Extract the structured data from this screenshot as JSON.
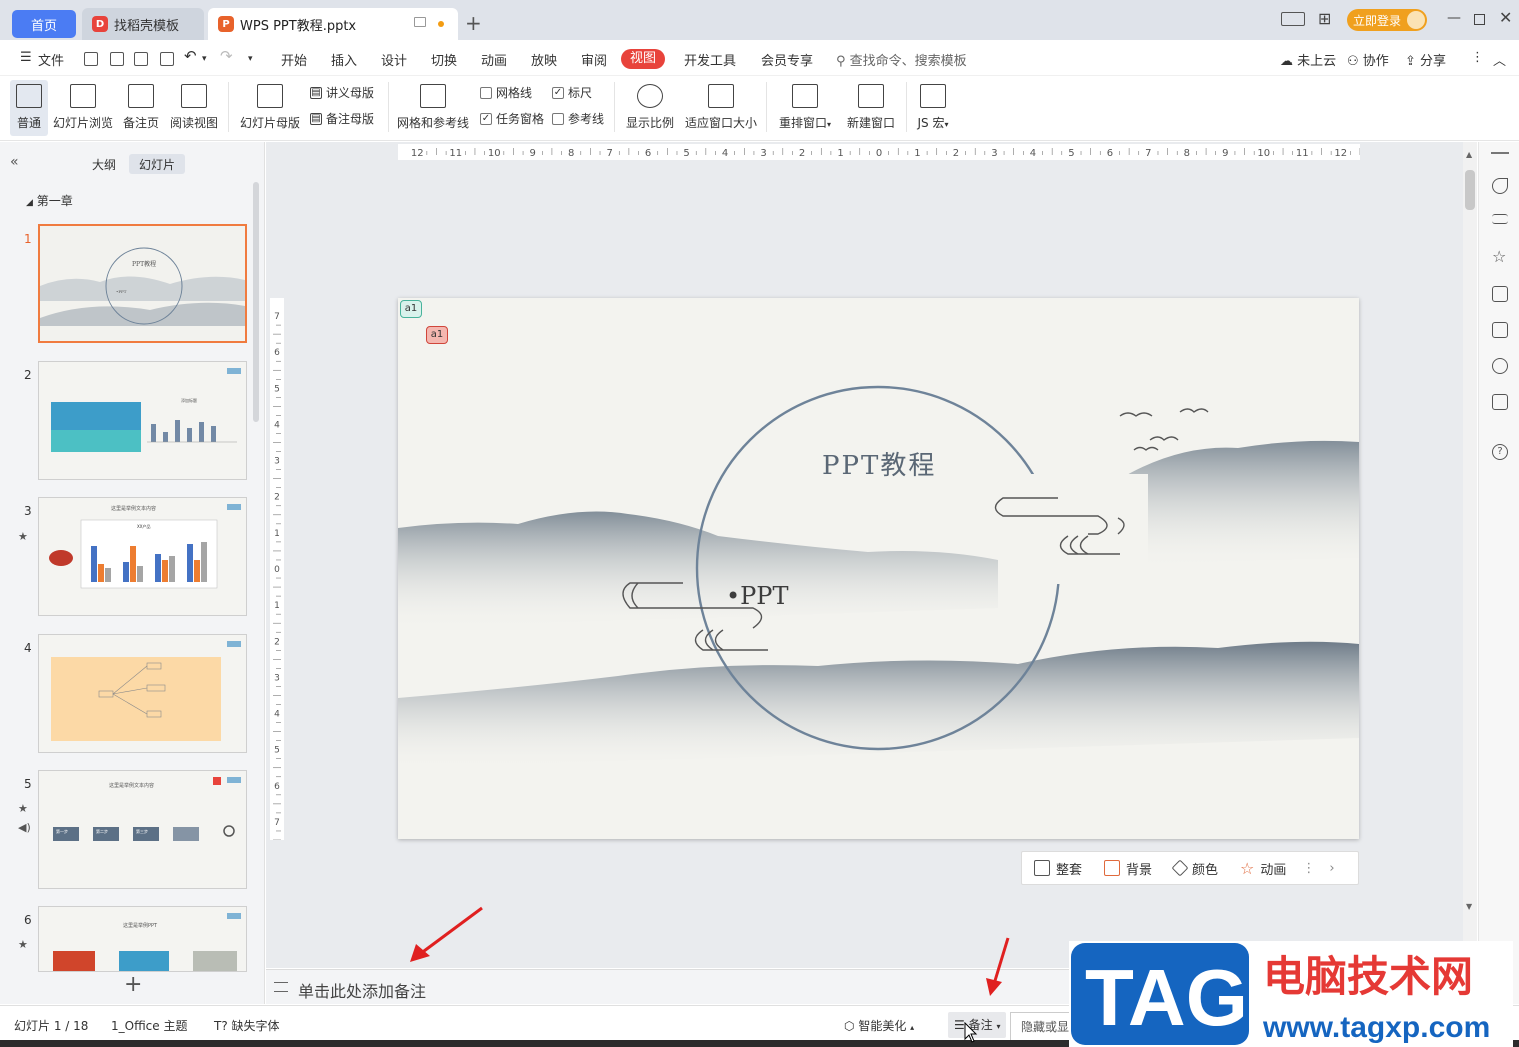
{
  "tabs": {
    "home": "首页",
    "template": "找稻壳模板",
    "document": "WPS PPT教程.pptx"
  },
  "window": {
    "login": "立即登录",
    "layout_icon": "layout-icon",
    "grid_icon": "grid-icon"
  },
  "menu": {
    "file": "文件",
    "items": [
      "开始",
      "插入",
      "设计",
      "切换",
      "动画",
      "放映",
      "审阅"
    ],
    "active": "视图",
    "items_after": [
      "开发工具",
      "会员专享"
    ],
    "search": "查找命令、搜索模板",
    "cloud": "未上云",
    "collab": "协作",
    "share": "分享"
  },
  "ribbon": {
    "normal": "普通",
    "slide_browse": "幻灯片浏览",
    "notes_page": "备注页",
    "reading_view": "阅读视图",
    "slide_master": "幻灯片母版",
    "handout_master": "讲义母版",
    "notes_master": "备注母版",
    "grid_guides": "网格和参考线",
    "gridlines": "网格线",
    "ruler": "标尺",
    "task_pane": "任务窗格",
    "guides": "参考线",
    "zoom": "显示比例",
    "fit_window": "适应窗口大小",
    "arrange": "重排窗口",
    "new_window": "新建窗口",
    "macro": "JS 宏"
  },
  "left_panel": {
    "outline_tab": "大纲",
    "slides_tab": "幻灯片",
    "section": "第一章",
    "slides": [
      {
        "num": "1",
        "title": "PPT教程",
        "subtitle": "•PPT"
      },
      {
        "num": "2",
        "title": "添加标题"
      },
      {
        "num": "3",
        "title": "这里是举例文本内容",
        "chart_title": "XX产品"
      },
      {
        "num": "4"
      },
      {
        "num": "5",
        "title": "这里是举例文本内容",
        "steps": [
          "第一步",
          "第二步",
          "第三步"
        ],
        "step_sub": "XXX"
      },
      {
        "num": "6",
        "title": "这里是举例PPT"
      }
    ]
  },
  "ruler": {
    "h_ticks": [
      "12",
      "11",
      "10",
      "9",
      "8",
      "7",
      "6",
      "5",
      "4",
      "3",
      "2",
      "1",
      "0",
      "1",
      "2",
      "3",
      "4",
      "5",
      "6",
      "7",
      "8",
      "9",
      "10",
      "11",
      "12"
    ],
    "v_ticks": [
      "7",
      "6",
      "5",
      "4",
      "3",
      "2",
      "1",
      "0",
      "1",
      "2",
      "3",
      "4",
      "5",
      "6",
      "7"
    ]
  },
  "slide": {
    "title": "PPT教程",
    "bullet": "•PPT",
    "comment_1": "a1",
    "comment_2": "a1"
  },
  "float_bar": {
    "layout": "整套",
    "background": "背景",
    "color": "颜色",
    "animation": "动画"
  },
  "notes": {
    "placeholder": "单击此处添加备注"
  },
  "status": {
    "slide_count": "幻灯片 1 / 18",
    "theme": "1_Office 主题",
    "missing_font": "缺失字体",
    "smart_beautify": "智能美化",
    "notes_toggle": "备注",
    "tooltip": "隐藏或显"
  },
  "watermark": {
    "tag": "TAG",
    "site_name": "电脑技术网",
    "url": "www.tagxp.com"
  },
  "colors": {
    "accent_blue": "#4b7cf3",
    "active_red": "#e8433b",
    "login_orange": "#f0a01e",
    "thumb_selected": "#f07b3f",
    "watermark_blue": "#1565c0",
    "watermark_red": "#e53935"
  }
}
